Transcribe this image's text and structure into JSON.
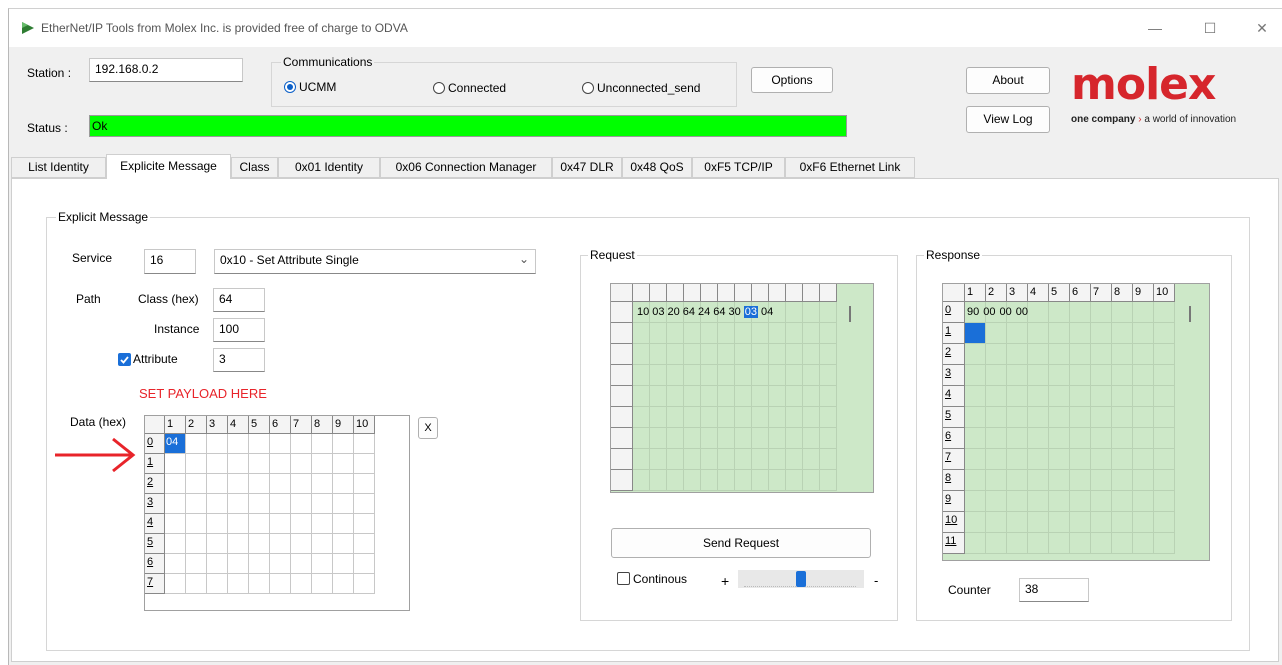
{
  "window": {
    "title": "EtherNet/IP Tools from Molex Inc. is provided free of charge to ODVA",
    "controls": {
      "minimize": "—",
      "maximize": "☐",
      "close": "✕"
    }
  },
  "header": {
    "station_label": "Station :",
    "station_value": "192.168.0.2",
    "status_label": "Status :",
    "status_value": "Ok",
    "status_color": "#00ff00",
    "communications": {
      "title": "Communications",
      "options": [
        {
          "label": "UCMM",
          "selected": true
        },
        {
          "label": "Connected",
          "selected": false
        },
        {
          "label": "Unconnected_send",
          "selected": false
        }
      ]
    },
    "options_button": "Options",
    "about_button": "About",
    "viewlog_button": "View Log",
    "logo": {
      "name": "molex",
      "tagline": "one company",
      "tagline_rest": "a world of innovation",
      "color": "#d6262c"
    }
  },
  "tabs": [
    {
      "label": "List Identity",
      "active": false
    },
    {
      "label": "Explicite Message",
      "active": true
    },
    {
      "label": "Class",
      "active": false
    },
    {
      "label": "0x01 Identity",
      "active": false
    },
    {
      "label": "0x06 Connection Manager",
      "active": false
    },
    {
      "label": "0x47 DLR",
      "active": false
    },
    {
      "label": "0x48 QoS",
      "active": false
    },
    {
      "label": "0xF5 TCP/IP",
      "active": false
    },
    {
      "label": "0xF6 Ethernet Link",
      "active": false
    }
  ],
  "explicit": {
    "group_title": "Explicit Message",
    "service_label": "Service",
    "service_value": "16",
    "service_select": "0x10 - Set Attribute Single",
    "path_label": "Path",
    "class_label": "Class (hex)",
    "class_value": "64",
    "instance_label": "Instance",
    "instance_value": "100",
    "attribute_label": "Attribute",
    "attribute_checked": true,
    "attribute_value": "3",
    "annotation": "SET PAYLOAD HERE",
    "annotation_color": "#e8242a",
    "data_label": "Data (hex)",
    "clear_button": "X",
    "data_grid": {
      "columns": [
        "1",
        "2",
        "3",
        "4",
        "5",
        "6",
        "7",
        "8",
        "9",
        "10"
      ],
      "rows": [
        "0",
        "1",
        "2",
        "3",
        "4",
        "5",
        "6",
        "7"
      ],
      "values": [
        [
          "04"
        ]
      ],
      "selected": [
        0,
        0
      ]
    }
  },
  "request": {
    "group_title": "Request",
    "row0": [
      "10",
      "03",
      "20",
      "64",
      "24",
      "64",
      "30",
      "03",
      "04"
    ],
    "selected_index": 7,
    "send_button": "Send Request",
    "continuous_label": "Continous",
    "continuous_checked": false,
    "slider_plus": "+",
    "slider_minus": "-",
    "slider_level": 0.5,
    "grid_color": "#cde8c8"
  },
  "response": {
    "group_title": "Response",
    "columns": [
      "1",
      "2",
      "3",
      "4",
      "5",
      "6",
      "7",
      "8",
      "9",
      "10"
    ],
    "rows": [
      "0",
      "1",
      "2",
      "3",
      "4",
      "5",
      "6",
      "7",
      "8",
      "9",
      "10",
      "11"
    ],
    "row0": [
      "90",
      "00",
      "00",
      "00"
    ],
    "counter_label": "Counter",
    "counter_value": "38"
  }
}
